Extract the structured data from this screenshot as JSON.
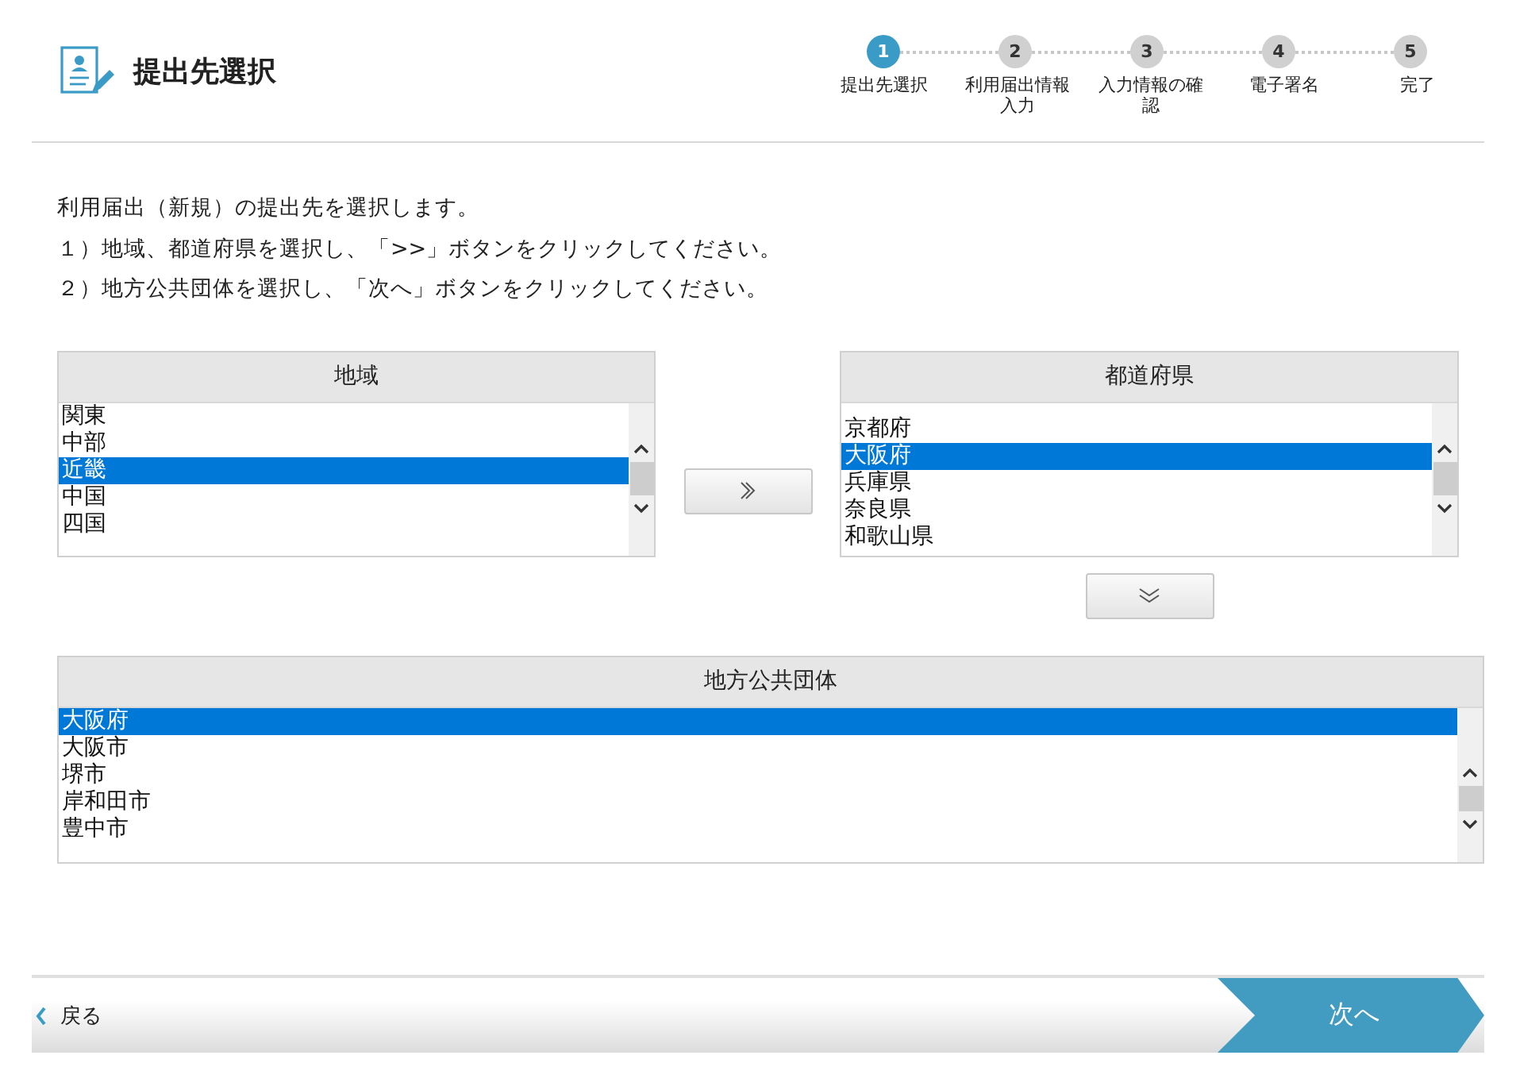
{
  "header": {
    "title": "提出先選択"
  },
  "steps": [
    {
      "number": "1",
      "label": "提出先選択",
      "selected": true
    },
    {
      "number": "2",
      "label": "利用届出情報入力",
      "selected": false
    },
    {
      "number": "3",
      "label": "入力情報の確認",
      "selected": false
    },
    {
      "number": "4",
      "label": "電子署名",
      "selected": false
    },
    {
      "number": "5",
      "label": "完了",
      "selected": false
    }
  ],
  "instructions": [
    "利用届出（新規）の提出先を選択します。",
    "１）地域、都道府県を選択し、「>>」ボタンをクリックしてください。",
    "２）地方公共団体を選択し、「次へ」ボタンをクリックしてください。"
  ],
  "region_list": {
    "heading": "地域",
    "items": [
      {
        "label": "関東",
        "selected": false
      },
      {
        "label": "中部",
        "selected": false
      },
      {
        "label": "近畿",
        "selected": true
      },
      {
        "label": "中国",
        "selected": false
      },
      {
        "label": "四国",
        "selected": false
      }
    ]
  },
  "prefecture_list": {
    "heading": "都道府県",
    "items": [
      {
        "label": "京都府",
        "selected": false
      },
      {
        "label": "大阪府",
        "selected": true
      },
      {
        "label": "兵庫県",
        "selected": false
      },
      {
        "label": "奈良県",
        "selected": false
      },
      {
        "label": "和歌山県",
        "selected": false
      }
    ]
  },
  "municipality_list": {
    "heading": "地方公共団体",
    "items": [
      {
        "label": "大阪府",
        "selected": true
      },
      {
        "label": "大阪市",
        "selected": false
      },
      {
        "label": "堺市",
        "selected": false
      },
      {
        "label": "岸和田市",
        "selected": false
      },
      {
        "label": "豊中市",
        "selected": false
      }
    ]
  },
  "footer": {
    "back": "戻る",
    "next": "次へ"
  }
}
